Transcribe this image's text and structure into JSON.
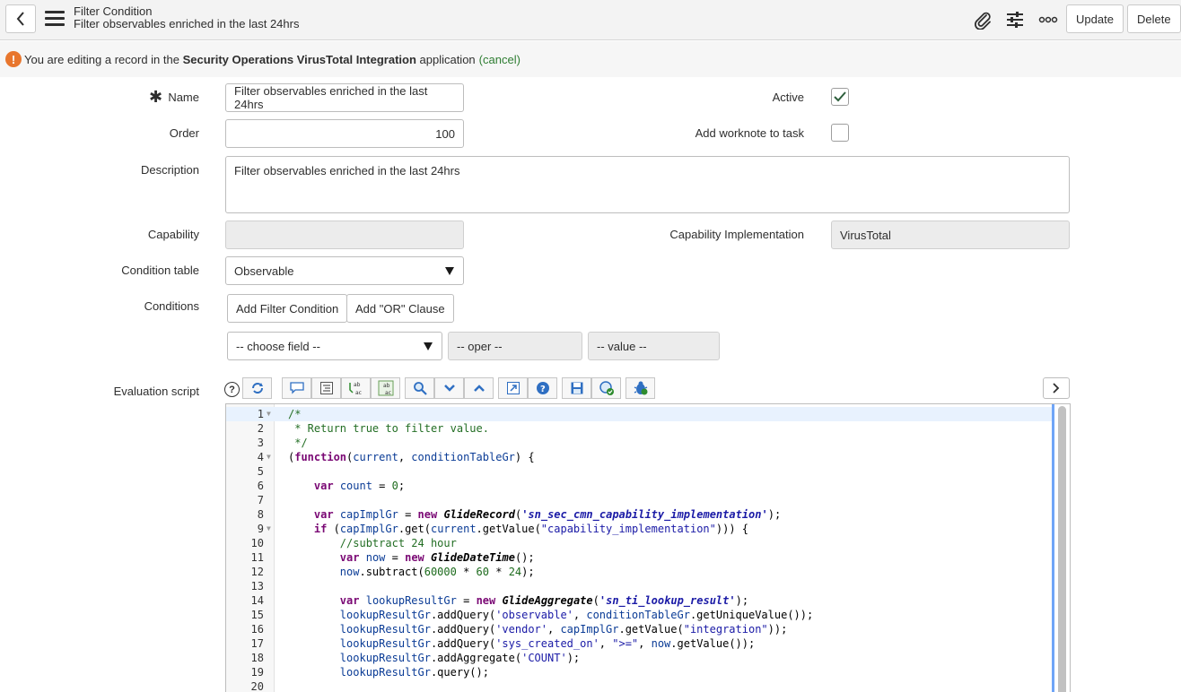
{
  "header": {
    "title": "Filter Condition",
    "subtitle": "Filter observables enriched in the last 24hrs",
    "update_label": "Update",
    "delete_label": "Delete"
  },
  "notice": {
    "prefix": "You are editing a record in the ",
    "app_name": "Security Operations VirusTotal Integration",
    "suffix": " application",
    "cancel_link": "(cancel)"
  },
  "form": {
    "name_label": "Name",
    "name_value": "Filter observables enriched in the last 24hrs",
    "order_label": "Order",
    "order_value": "100",
    "description_label": "Description",
    "description_value": "Filter observables enriched in the last 24hrs",
    "active_label": "Active",
    "active_checked": true,
    "worknote_label": "Add worknote to task",
    "worknote_checked": false,
    "capability_label": "Capability",
    "capability_value": "",
    "cap_impl_label": "Capability Implementation",
    "cap_impl_value": "VirusTotal",
    "condition_table_label": "Condition table",
    "condition_table_value": "Observable",
    "conditions_label": "Conditions",
    "add_filter_label": "Add Filter Condition",
    "add_or_label": "Add \"OR\" Clause",
    "choose_field": "-- choose field --",
    "oper": "-- oper --",
    "value": "-- value --",
    "eval_script_label": "Evaluation script"
  },
  "toolbar": {
    "icons": [
      "toggle-syntax-icon",
      "comment-icon",
      "format-icon",
      "replace-icon",
      "replace-all-icon",
      "search-icon",
      "collapse-icon",
      "expand-icon",
      "fullscreen-icon",
      "help-icon",
      "save-icon",
      "script-check-icon",
      "debug-icon"
    ]
  },
  "code": {
    "lines": [
      {
        "n": "1",
        "fold": true,
        "html": "<span class='cm'>/*</span>"
      },
      {
        "n": "2",
        "fold": false,
        "html": "<span class='cm'> * Return true to filter value.</span>"
      },
      {
        "n": "3",
        "fold": false,
        "html": "<span class='cm'> */</span>"
      },
      {
        "n": "4",
        "fold": true,
        "html": "(<span class='kw'>function</span>(<span class='vr'>current</span>, <span class='vr'>conditionTableGr</span>) {"
      },
      {
        "n": "5",
        "fold": false,
        "html": ""
      },
      {
        "n": "6",
        "fold": false,
        "html": "    <span class='kw'>var</span> <span class='vr'>count</span> = <span class='num'>0</span>;"
      },
      {
        "n": "7",
        "fold": false,
        "html": ""
      },
      {
        "n": "8",
        "fold": false,
        "html": "    <span class='kw'>var</span> <span class='vr'>capImplGr</span> = <span class='kw'>new</span> <span class='kw2'>GlideRecord</span>(<span class='stri'>'sn_sec_cmn_capability_implementation'</span>);"
      },
      {
        "n": "9",
        "fold": true,
        "html": "    <span class='kw'>if</span> (<span class='vr'>capImplGr</span>.get(<span class='vr'>current</span>.getValue(<span class='str'>\"capability_implementation\"</span>))) {"
      },
      {
        "n": "10",
        "fold": false,
        "html": "        <span class='cm'>//subtract 24 hour</span>"
      },
      {
        "n": "11",
        "fold": false,
        "html": "        <span class='kw'>var</span> <span class='vr'>now</span> = <span class='kw'>new</span> <span class='kw2'>GlideDateTime</span>();"
      },
      {
        "n": "12",
        "fold": false,
        "html": "        <span class='vr'>now</span>.subtract(<span class='num'>60000</span> * <span class='num'>60</span> * <span class='num'>24</span>);"
      },
      {
        "n": "13",
        "fold": false,
        "html": ""
      },
      {
        "n": "14",
        "fold": false,
        "html": "        <span class='kw'>var</span> <span class='vr'>lookupResultGr</span> = <span class='kw'>new</span> <span class='kw2'>GlideAggregate</span>(<span class='stri'>'sn_ti_lookup_result'</span>);"
      },
      {
        "n": "15",
        "fold": false,
        "html": "        <span class='vr'>lookupResultGr</span>.addQuery(<span class='str'>'observable'</span>, <span class='vr'>conditionTableGr</span>.getUniqueValue());"
      },
      {
        "n": "16",
        "fold": false,
        "html": "        <span class='vr'>lookupResultGr</span>.addQuery(<span class='str'>'vendor'</span>, <span class='vr'>capImplGr</span>.getValue(<span class='str'>\"integration\"</span>));"
      },
      {
        "n": "17",
        "fold": false,
        "html": "        <span class='vr'>lookupResultGr</span>.addQuery(<span class='str'>'sys_created_on'</span>, <span class='str'>\">=\"</span>, <span class='vr'>now</span>.getValue());"
      },
      {
        "n": "18",
        "fold": false,
        "html": "        <span class='vr'>lookupResultGr</span>.addAggregate(<span class='str'>'COUNT'</span>);"
      },
      {
        "n": "19",
        "fold": false,
        "html": "        <span class='vr'>lookupResultGr</span>.query();"
      },
      {
        "n": "20",
        "fold": false,
        "html": ""
      }
    ]
  }
}
